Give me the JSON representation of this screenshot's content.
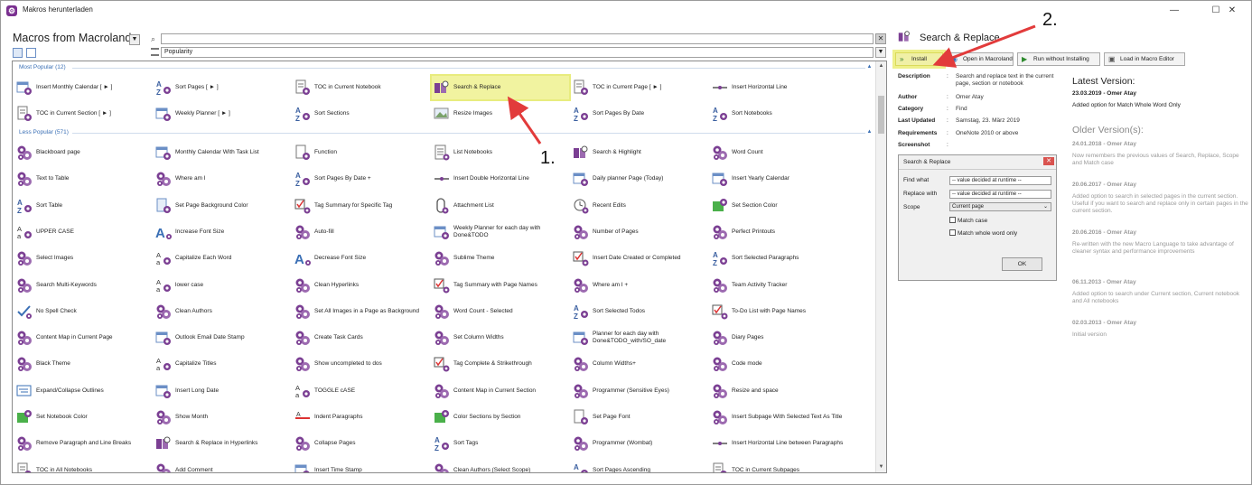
{
  "window": {
    "title": "Makros herunterladen"
  },
  "left": {
    "title": "Macros from Macroland",
    "search": {
      "value": "",
      "placeholder": ""
    },
    "sort": {
      "selected": "Popularity"
    },
    "groups": {
      "most": "Most Popular (12)",
      "less": "Less Popular (571)"
    }
  },
  "most_popular": [
    {
      "label": "Insert Monthly Calendar [ ► ]",
      "icon": "calendar-icon"
    },
    {
      "label": "Sort Pages [ ► ]",
      "icon": "sort-az-icon"
    },
    {
      "label": "TOC in Current Notebook",
      "icon": "toc-icon"
    },
    {
      "label": "Search & Replace",
      "icon": "search-replace-icon"
    },
    {
      "label": "TOC in Current Page [ ► ]",
      "icon": "toc-icon"
    },
    {
      "label": "Insert Horizontal Line",
      "icon": "horizontal-line-icon"
    },
    {
      "label": "TOC in Current Section [ ► ]",
      "icon": "toc-icon"
    },
    {
      "label": "Weekly Planner [ ► ]",
      "icon": "calendar-icon"
    },
    {
      "label": "Sort Sections",
      "icon": "sort-az-icon"
    },
    {
      "label": "Resize Images",
      "icon": "image-icon"
    },
    {
      "label": "Sort Pages By Date",
      "icon": "sort-az-icon"
    },
    {
      "label": "Sort Notebooks",
      "icon": "sort-az-icon"
    }
  ],
  "less_popular": [
    {
      "label": "Blackboard page",
      "icon": "gears-icon"
    },
    {
      "label": "Monthly Calendar With Task List",
      "icon": "calendar-icon"
    },
    {
      "label": "Function",
      "icon": "page-icon"
    },
    {
      "label": "List Notebooks",
      "icon": "list-icon"
    },
    {
      "label": "Search & Highlight",
      "icon": "search-replace-icon"
    },
    {
      "label": "Word Count",
      "icon": "gears-icon"
    },
    {
      "label": "Text to Table",
      "icon": "gears-icon"
    },
    {
      "label": "Where am I",
      "icon": "gears-icon"
    },
    {
      "label": "Sort Pages By Date +",
      "icon": "sort-az-icon"
    },
    {
      "label": "Insert Double Horizontal Line",
      "icon": "horizontal-line-icon"
    },
    {
      "label": "Daily planner Page (Today)",
      "icon": "calendar-icon"
    },
    {
      "label": "Insert Yearly Calendar",
      "icon": "calendar-icon"
    },
    {
      "label": "Sort Table",
      "icon": "sort-az-icon"
    },
    {
      "label": "Set Page Background Color",
      "icon": "page-color-icon"
    },
    {
      "label": "Tag Summary for Specific Tag",
      "icon": "checkbox-icon"
    },
    {
      "label": "Attachment List",
      "icon": "attachment-icon"
    },
    {
      "label": "Recent Edits",
      "icon": "recent-icon"
    },
    {
      "label": "Set Section Color",
      "icon": "section-color-icon"
    },
    {
      "label": "UPPER CASE",
      "icon": "case-icon"
    },
    {
      "label": "Increase Font Size",
      "icon": "font-size-icon"
    },
    {
      "label": "Auto-fill",
      "icon": "gears-icon"
    },
    {
      "label": "Weekly Planner for each day with Done&TODO",
      "icon": "calendar-icon"
    },
    {
      "label": "Number of Pages",
      "icon": "gears-icon"
    },
    {
      "label": "Perfect Printouts",
      "icon": "gears-icon"
    },
    {
      "label": "Select Images",
      "icon": "gears-icon"
    },
    {
      "label": "Capitalize Each Word",
      "icon": "case-icon"
    },
    {
      "label": "Decrease Font Size",
      "icon": "font-size-icon"
    },
    {
      "label": "Sublime Theme",
      "icon": "gears-icon"
    },
    {
      "label": "Insert Date Created or Completed",
      "icon": "checkbox-icon"
    },
    {
      "label": "Sort Selected Paragraphs",
      "icon": "sort-az-icon"
    },
    {
      "label": "Search Multi-Keywords",
      "icon": "gears-icon"
    },
    {
      "label": "lower case",
      "icon": "case-icon"
    },
    {
      "label": "Clean Hyperlinks",
      "icon": "gears-icon"
    },
    {
      "label": "Tag Summary with Page Names",
      "icon": "checkbox-icon"
    },
    {
      "label": "Where am I +",
      "icon": "gears-icon"
    },
    {
      "label": "Team Activity Tracker",
      "icon": "gears-icon"
    },
    {
      "label": "No Spell Check",
      "icon": "spell-check-icon"
    },
    {
      "label": "Clean Authors",
      "icon": "gears-icon"
    },
    {
      "label": "Set All Images in a Page as Background",
      "icon": "gears-icon"
    },
    {
      "label": "Word Count - Selected",
      "icon": "gears-icon"
    },
    {
      "label": "Sort Selected Todos",
      "icon": "sort-az-icon"
    },
    {
      "label": "To-Do List with Page Names",
      "icon": "checkbox-icon"
    },
    {
      "label": "Content Map in Current Page",
      "icon": "gears-icon"
    },
    {
      "label": "Outlook Email Date Stamp",
      "icon": "calendar-icon"
    },
    {
      "label": "Create Task Cards",
      "icon": "gears-icon"
    },
    {
      "label": "Set Column Widths",
      "icon": "gears-icon"
    },
    {
      "label": "Planner for each day with Done&TODO_with/SO_date",
      "icon": "calendar-icon"
    },
    {
      "label": "Diary Pages",
      "icon": "gears-icon"
    },
    {
      "label": "Black Theme",
      "icon": "gears-icon"
    },
    {
      "label": "Capitalize Titles",
      "icon": "case-icon"
    },
    {
      "label": "Show uncompleted to dos",
      "icon": "gears-icon"
    },
    {
      "label": "Tag Complete & Strikethrough",
      "icon": "checkbox-icon"
    },
    {
      "label": "Column Widths+",
      "icon": "gears-icon"
    },
    {
      "label": "Code mode",
      "icon": "gears-icon"
    },
    {
      "label": "Expand/Collapse Outlines",
      "icon": "outline-icon"
    },
    {
      "label": "Insert Long Date",
      "icon": "calendar-icon"
    },
    {
      "label": "TOGGLE cASE",
      "icon": "case-icon"
    },
    {
      "label": "Content Map in Current Section",
      "icon": "gears-icon"
    },
    {
      "label": "Programmer (Sensitive Eyes)",
      "icon": "gears-icon"
    },
    {
      "label": "Resize and space",
      "icon": "gears-icon"
    },
    {
      "label": "Set Notebook Color",
      "icon": "section-color-icon"
    },
    {
      "label": "Show Month",
      "icon": "gears-icon"
    },
    {
      "label": "Indent Paragraphs",
      "icon": "indent-icon"
    },
    {
      "label": "Color Sections by Section",
      "icon": "section-color-icon"
    },
    {
      "label": "Set Page Font",
      "icon": "page-icon"
    },
    {
      "label": "Insert Subpage With Selected Text As Title",
      "icon": "gears-icon"
    },
    {
      "label": "Remove Paragraph and Line Breaks",
      "icon": "gears-icon"
    },
    {
      "label": "Search & Replace in Hyperlinks",
      "icon": "search-replace-icon"
    },
    {
      "label": "Collapse Pages",
      "icon": "gears-icon"
    },
    {
      "label": "Sort Tags",
      "icon": "sort-az-icon"
    },
    {
      "label": "Programmer (Wombat)",
      "icon": "gears-icon"
    },
    {
      "label": "Insert Horizontal Line between Paragraphs",
      "icon": "horizontal-line-icon"
    },
    {
      "label": "TOC in All Notebooks",
      "icon": "toc-icon"
    },
    {
      "label": "Add Comment",
      "icon": "gears-icon"
    },
    {
      "label": "Insert Time Stamp",
      "icon": "calendar-icon"
    },
    {
      "label": "Clean Authors (Select Scope)",
      "icon": "gears-icon"
    },
    {
      "label": "Sort Pages Ascending",
      "icon": "sort-az-icon"
    },
    {
      "label": "TOC in Current Subpages",
      "icon": "toc-icon"
    }
  ],
  "detail": {
    "title": "Search & Replace",
    "buttons": {
      "install": "Install",
      "open": "Open in Macroland",
      "run": "Run without Installing",
      "load": "Load in Macro Editor"
    },
    "description_label": "Description",
    "description": "Search and replace text in the current page, section or notebook",
    "author_label": "Author",
    "author": "Omer Atay",
    "category_label": "Category",
    "category": "Find",
    "updated_label": "Last Updated",
    "updated": "Samstag, 23. März 2019",
    "requirements_label": "Requirements",
    "requirements": "OneNote 2010 or above",
    "screenshot_label": "Screenshot",
    "colon": ":"
  },
  "dialog": {
    "title": "Search & Replace",
    "find_label": "Find what",
    "find_value": "-- value decided at runtime --",
    "replace_label": "Replace with",
    "replace_value": "-- value decided at runtime --",
    "scope_label": "Scope",
    "scope_value": "Current page",
    "match_case": "Match case",
    "match_whole": "Match whole word only",
    "ok": "OK"
  },
  "versions": {
    "latest_title": "Latest Version:",
    "latest": {
      "head": "23.03.2019 - Omer Atay",
      "text": "Added option for Match Whole Word Only"
    },
    "older_title": "Older Version(s):",
    "older": [
      {
        "head": "24.01.2018 - Omer Atay",
        "text": "Now remembers the previous values of Search, Replace, Scope and Match case"
      },
      {
        "head": "20.06.2017 - Omer Atay",
        "text": "Added option to search in selected pages in the current section. Useful if you want to search and replace only in certain pages in the current section."
      },
      {
        "head": "20.06.2016 - Omer Atay",
        "text": "Re-written with the new Macro Language to take advantage of cleaner syntax and performance improvements"
      },
      {
        "head": "06.11.2013 - Omer Atay",
        "text": "Added option to search under Current section, Current notebook and All notebooks"
      },
      {
        "head": "02.03.2013 - Omer Atay",
        "text": "Initial version"
      }
    ]
  },
  "annotations": {
    "step1": "1.",
    "step2": "2."
  },
  "colors": {
    "accent": "#7b3f93",
    "highlight": "#f1f3a0",
    "selection": "#cfe6fb",
    "arrow": "#e23b3b",
    "group_text": "#3a6fb5"
  }
}
